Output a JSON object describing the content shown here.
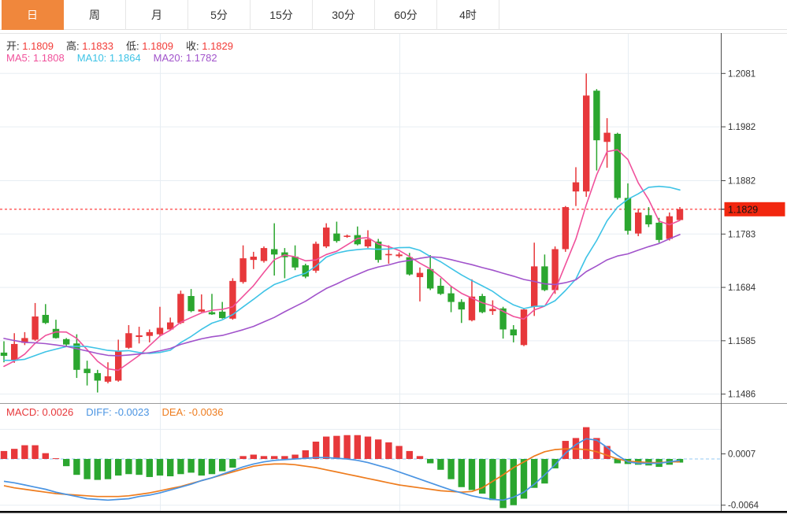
{
  "toolbar": {
    "tabs": [
      {
        "label": "日",
        "active": true
      },
      {
        "label": "周",
        "active": false
      },
      {
        "label": "月",
        "active": false
      },
      {
        "label": "5分",
        "active": false
      },
      {
        "label": "15分",
        "active": false
      },
      {
        "label": "30分",
        "active": false
      },
      {
        "label": "60分",
        "active": false
      },
      {
        "label": "4时",
        "active": false
      }
    ]
  },
  "colors": {
    "up": "#e7383b",
    "down": "#2ba62f",
    "ma5": "#f0519b",
    "ma10": "#3ec3e6",
    "ma20": "#a153cb",
    "diff": "#4a94e2",
    "dea": "#ee7c1e",
    "grid": "#e7edf3",
    "zero_dash": "#a9d3f5",
    "price_line": "#ff2d2d",
    "tag_bg": "#f2270f",
    "tag_text": "#141414",
    "axis_text": "#333333",
    "tab_active_bg": "#f0873c",
    "value_red": "#f23b37"
  },
  "ohlc_row": [
    {
      "label": "开:",
      "value": "1.1809"
    },
    {
      "label": "高:",
      "value": "1.1833"
    },
    {
      "label": "低:",
      "value": "1.1809"
    },
    {
      "label": "收:",
      "value": "1.1829"
    }
  ],
  "ma_row": [
    {
      "label": "MA5:",
      "value": "1.1808",
      "color": "#f0519b"
    },
    {
      "label": "MA10:",
      "value": "1.1864",
      "color": "#3ec3e6"
    },
    {
      "label": "MA20:",
      "value": "1.1782",
      "color": "#a153cb"
    }
  ],
  "macd_row": [
    {
      "label": "MACD:",
      "value": "0.0026",
      "color": "#e7383b"
    },
    {
      "label": "DIFF:",
      "value": "-0.0023",
      "color": "#4a94e2"
    },
    {
      "label": "DEA:",
      "value": "-0.0036",
      "color": "#ee7c1e"
    }
  ],
  "axis": {
    "price_ticks": [
      1.2081,
      1.1982,
      1.1882,
      1.1783,
      1.1684,
      1.1585,
      1.1486
    ],
    "price_tag": "1.1829",
    "macd_ticks": [
      0.0007,
      -0.0064
    ],
    "macd_grid_values": [
      0.0041,
      -0.0064
    ]
  },
  "chart_data": {
    "type": "candlestick",
    "title": "",
    "legend_position": "top-left",
    "grid": true,
    "price_panel": {
      "ylabel": "price",
      "ylim": [
        1.1455,
        1.2155
      ],
      "current_price": 1.1829,
      "ma_periods": [
        5,
        10,
        20
      ],
      "ma_seed_history": [
        1.1665,
        1.166,
        1.1655,
        1.165,
        1.1645,
        1.164,
        1.163,
        1.162,
        1.161,
        1.16,
        1.159,
        1.158,
        1.157,
        1.156,
        1.155,
        1.154,
        1.153,
        1.1525,
        1.153,
        1.1545
      ],
      "candles_ohlc": [
        [
          1.1563,
          1.1584,
          1.1545,
          1.1557
        ],
        [
          1.1548,
          1.1599,
          1.1544,
          1.1579
        ],
        [
          1.1581,
          1.1601,
          1.1577,
          1.159
        ],
        [
          1.1587,
          1.1655,
          1.1585,
          1.163
        ],
        [
          1.1633,
          1.1653,
          1.1616,
          1.1618
        ],
        [
          1.1607,
          1.1624,
          1.1589,
          1.159
        ],
        [
          1.1588,
          1.159,
          1.1575,
          1.1578
        ],
        [
          1.158,
          1.1597,
          1.1516,
          1.1531
        ],
        [
          1.1533,
          1.1548,
          1.1502,
          1.1525
        ],
        [
          1.1525,
          1.1531,
          1.1489,
          1.1511
        ],
        [
          1.1509,
          1.1545,
          1.1506,
          1.1519
        ],
        [
          1.1511,
          1.1587,
          1.1509,
          1.1565
        ],
        [
          1.1572,
          1.1614,
          1.157,
          1.1599
        ],
        [
          1.1592,
          1.1611,
          1.158,
          1.1595
        ],
        [
          1.1594,
          1.1606,
          1.1582,
          1.1601
        ],
        [
          1.1597,
          1.1648,
          1.1594,
          1.1609
        ],
        [
          1.1606,
          1.1628,
          1.1604,
          1.1619
        ],
        [
          1.1618,
          1.1678,
          1.1616,
          1.1672
        ],
        [
          1.1668,
          1.1681,
          1.1638,
          1.164
        ],
        [
          1.1639,
          1.1671,
          1.1638,
          1.1643
        ],
        [
          1.1638,
          1.1672,
          1.1633,
          1.1634
        ],
        [
          1.1639,
          1.1657,
          1.1626,
          1.1627
        ],
        [
          1.1626,
          1.1701,
          1.1624,
          1.1696
        ],
        [
          1.1694,
          1.1762,
          1.1691,
          1.1738
        ],
        [
          1.1735,
          1.175,
          1.1718,
          1.1741
        ],
        [
          1.1733,
          1.176,
          1.173,
          1.1757
        ],
        [
          1.1755,
          1.1803,
          1.1706,
          1.1745
        ],
        [
          1.1749,
          1.1757,
          1.1701,
          1.174
        ],
        [
          1.1741,
          1.1762,
          1.1716,
          1.1721
        ],
        [
          1.1725,
          1.1728,
          1.1701,
          1.1704
        ],
        [
          1.1715,
          1.1769,
          1.1711,
          1.1765
        ],
        [
          1.176,
          1.1803,
          1.1757,
          1.1795
        ],
        [
          1.1784,
          1.1806,
          1.1767,
          1.177
        ],
        [
          1.1778,
          1.1782,
          1.1776,
          1.178
        ],
        [
          1.1781,
          1.1797,
          1.1762,
          1.1764
        ],
        [
          1.176,
          1.179,
          1.1757,
          1.1773
        ],
        [
          1.1769,
          1.1774,
          1.173,
          1.1735
        ],
        [
          1.1744,
          1.1762,
          1.1728,
          1.1746
        ],
        [
          1.1742,
          1.1749,
          1.1739,
          1.1745
        ],
        [
          1.174,
          1.1748,
          1.1706,
          1.1708
        ],
        [
          1.1703,
          1.1721,
          1.1658,
          1.1711
        ],
        [
          1.1718,
          1.1744,
          1.1679,
          1.1682
        ],
        [
          1.1687,
          1.1701,
          1.167,
          1.1672
        ],
        [
          1.1673,
          1.1687,
          1.1638,
          1.1657
        ],
        [
          1.1657,
          1.1662,
          1.1618,
          1.1643
        ],
        [
          1.1623,
          1.1699,
          1.1621,
          1.1667
        ],
        [
          1.1668,
          1.1672,
          1.1636,
          1.1638
        ],
        [
          1.164,
          1.166,
          1.1633,
          1.1644
        ],
        [
          1.1645,
          1.1648,
          1.1589,
          1.1606
        ],
        [
          1.1606,
          1.1614,
          1.1582,
          1.1595
        ],
        [
          1.1577,
          1.1645,
          1.1575,
          1.1643
        ],
        [
          1.1648,
          1.1767,
          1.1631,
          1.1723
        ],
        [
          1.1723,
          1.1745,
          1.1677,
          1.1679
        ],
        [
          1.1679,
          1.176,
          1.1672,
          1.1755
        ],
        [
          1.1755,
          1.1835,
          1.175,
          1.1833
        ],
        [
          1.1862,
          1.1907,
          1.1835,
          1.1879
        ],
        [
          1.1862,
          1.2081,
          1.1852,
          1.204
        ],
        [
          1.2049,
          1.2052,
          1.1901,
          1.1957
        ],
        [
          1.1954,
          1.1998,
          1.1906,
          1.1971
        ],
        [
          1.1969,
          1.1971,
          1.1847,
          1.185
        ],
        [
          1.185,
          1.1877,
          1.1782,
          1.1789
        ],
        [
          1.1784,
          1.183,
          1.1779,
          1.1823
        ],
        [
          1.1818,
          1.1833,
          1.1796,
          1.1801
        ],
        [
          1.1804,
          1.1813,
          1.1767,
          1.1772
        ],
        [
          1.1774,
          1.1823,
          1.1771,
          1.1816
        ],
        [
          1.1809,
          1.1833,
          1.1809,
          1.1829
        ]
      ]
    },
    "macd_panel": {
      "ylabel": "MACD(12,26,9)",
      "hist": [
        0.0011,
        0.0014,
        0.0019,
        0.0019,
        0.0008,
        0.0001,
        -0.001,
        -0.0022,
        -0.0028,
        -0.0029,
        -0.0028,
        -0.0023,
        -0.0021,
        -0.0022,
        -0.0025,
        -0.0023,
        -0.0024,
        -0.0021,
        -0.0019,
        -0.0023,
        -0.0021,
        -0.0017,
        -0.0012,
        0.0004,
        0.0006,
        0.0004,
        0.0004,
        0.0004,
        0.0006,
        0.0012,
        0.0024,
        0.0031,
        0.0032,
        0.0033,
        0.0033,
        0.0031,
        0.0027,
        0.0023,
        0.0018,
        0.0011,
        0.0004,
        -0.0006,
        -0.0015,
        -0.0028,
        -0.0039,
        -0.0043,
        -0.0048,
        -0.0057,
        -0.0068,
        -0.0064,
        -0.0055,
        -0.004,
        -0.0034,
        -0.0013,
        0.0025,
        0.0029,
        0.0044,
        0.0029,
        0.0018,
        -0.0006,
        -0.0007,
        -0.0008,
        -0.0009,
        -0.0011,
        -0.0008,
        -0.0005
      ],
      "diff": [
        -0.0031,
        -0.0033,
        -0.0036,
        -0.0039,
        -0.0042,
        -0.0046,
        -0.0049,
        -0.0052,
        -0.0055,
        -0.0056,
        -0.0057,
        -0.0056,
        -0.0055,
        -0.0052,
        -0.005,
        -0.0047,
        -0.0043,
        -0.0039,
        -0.0035,
        -0.003,
        -0.0026,
        -0.0021,
        -0.0016,
        -0.0011,
        -0.0007,
        -0.0004,
        -0.0002,
        -0.0001,
        0.0,
        0.0001,
        0.0002,
        0.0002,
        0.0001,
        0.0,
        -0.0002,
        -0.0005,
        -0.0009,
        -0.0013,
        -0.0018,
        -0.0023,
        -0.0028,
        -0.0033,
        -0.0038,
        -0.0043,
        -0.0047,
        -0.0051,
        -0.0054,
        -0.0056,
        -0.0057,
        -0.0053,
        -0.0046,
        -0.0035,
        -0.0022,
        -0.0008,
        0.0008,
        0.002,
        0.0028,
        0.0026,
        0.0016,
        0.0005,
        -0.0004,
        -0.0006,
        -0.0006,
        -0.0006,
        -0.0004,
        -0.0002
      ],
      "dea": [
        -0.0037,
        -0.004,
        -0.0042,
        -0.0044,
        -0.0046,
        -0.0048,
        -0.0049,
        -0.005,
        -0.0051,
        -0.0052,
        -0.0052,
        -0.0052,
        -0.0051,
        -0.0049,
        -0.0047,
        -0.0044,
        -0.0041,
        -0.0038,
        -0.0034,
        -0.003,
        -0.0026,
        -0.0022,
        -0.0018,
        -0.0014,
        -0.001,
        -0.0008,
        -0.0007,
        -0.0007,
        -0.0008,
        -0.001,
        -0.0012,
        -0.0015,
        -0.0018,
        -0.0021,
        -0.0024,
        -0.0027,
        -0.003,
        -0.0033,
        -0.0036,
        -0.0038,
        -0.004,
        -0.0042,
        -0.0044,
        -0.0045,
        -0.0046,
        -0.0045,
        -0.004,
        -0.0031,
        -0.0022,
        -0.0012,
        -0.0004,
        0.0004,
        0.001,
        0.0013,
        0.0014,
        0.0014,
        0.0013,
        0.001,
        0.0005,
        0.0,
        -0.0003,
        -0.0004,
        -0.0005,
        -0.0005,
        -0.0004,
        -0.0004
      ]
    }
  }
}
